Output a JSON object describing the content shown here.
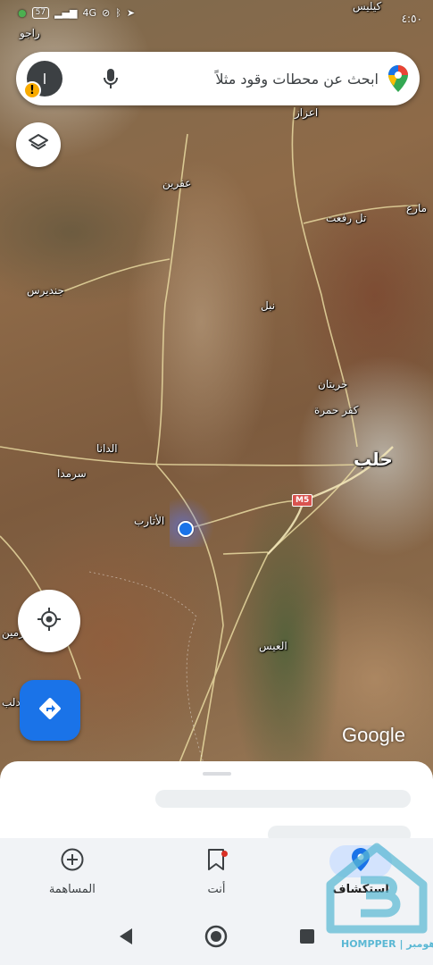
{
  "status_bar": {
    "time": "٤:٥٠",
    "battery": "57",
    "signal_text": "4G"
  },
  "search": {
    "placeholder": "ابحث عن محطات وقود مثلاً",
    "avatar_letter": "ا"
  },
  "map": {
    "labels": [
      {
        "text": "كيليس",
        "kind": "place"
      },
      {
        "text": "راجو",
        "kind": "place"
      },
      {
        "text": "اعزاز",
        "kind": "place"
      },
      {
        "text": "عفرين",
        "kind": "place"
      },
      {
        "text": "مارع",
        "kind": "place"
      },
      {
        "text": "تل رفعت",
        "kind": "place"
      },
      {
        "text": "جنديرس",
        "kind": "place"
      },
      {
        "text": "نبل",
        "kind": "place"
      },
      {
        "text": "حريتان",
        "kind": "place"
      },
      {
        "text": "كفر حمرة",
        "kind": "place"
      },
      {
        "text": "حلب",
        "kind": "city"
      },
      {
        "text": "الدانا",
        "kind": "place"
      },
      {
        "text": "سرمدا",
        "kind": "place"
      },
      {
        "text": "الأتارب",
        "kind": "place"
      },
      {
        "text": "العيس",
        "kind": "place"
      },
      {
        "text": "ارمين",
        "kind": "place"
      },
      {
        "text": "ادلب",
        "kind": "place"
      }
    ],
    "road_shield": "M5",
    "logo": "Google"
  },
  "nav": {
    "items": [
      {
        "label": "المساهمة",
        "icon": "add-circle-icon",
        "active": false
      },
      {
        "label": "أنت",
        "icon": "bookmark-icon",
        "active": false
      },
      {
        "label": "استكشاف",
        "icon": "location-pin-icon",
        "active": true
      }
    ]
  },
  "watermark": {
    "text": "HOMPPER | هومبر"
  },
  "colors": {
    "accent": "#1a73e8",
    "warning": "#f9ab00",
    "nav_active_bg": "#d3e3fd",
    "road_shield": "#d9534f"
  }
}
